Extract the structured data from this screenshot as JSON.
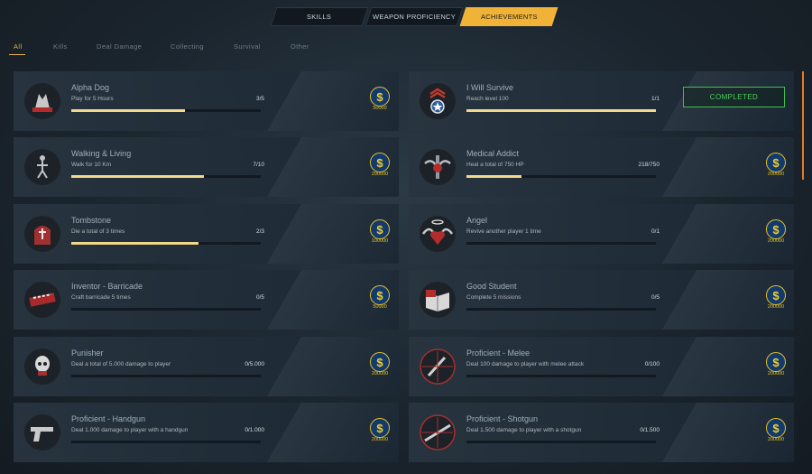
{
  "main_tabs": [
    {
      "label": "SKILLS",
      "active": false
    },
    {
      "label": "WEAPON PROFICIENCY",
      "active": false
    },
    {
      "label": "ACHIEVEMENTS",
      "active": true
    }
  ],
  "filters": [
    "All",
    "Kills",
    "Deal Damage",
    "Collecting",
    "Survival",
    "Other"
  ],
  "active_filter": "All",
  "colors": {
    "accent": "#f0b338",
    "progress": "#f2d88a",
    "completed": "#49d059",
    "coin_gold": "#e7c22b",
    "coin_blue": "#123a6d"
  },
  "achievements": [
    {
      "title": "Alpha Dog",
      "desc": "Play for 5 Hours",
      "count": "3/5",
      "progress": 0.6,
      "reward": "50000",
      "icon": "wolf-emblem-icon",
      "completed": false
    },
    {
      "title": "I Will Survive",
      "desc": "Reach level 100",
      "count": "1/1",
      "progress": 1.0,
      "reward": "",
      "icon": "military-rank-badge-icon",
      "completed": true,
      "status": "COMPLETED"
    },
    {
      "title": "Walking & Living",
      "desc": "Walk for 10 Km",
      "count": "7/10",
      "progress": 0.7,
      "reward": "200000",
      "icon": "walking-figure-icon",
      "completed": false
    },
    {
      "title": "Medical Addict",
      "desc": "Heal a total of 750 HP",
      "count": "218/750",
      "progress": 0.29,
      "reward": "200000",
      "icon": "winged-medic-emblem-icon",
      "completed": false
    },
    {
      "title": "Tombstone",
      "desc": "Die a total of 3 times",
      "count": "2/3",
      "progress": 0.67,
      "reward": "100000",
      "icon": "tombstone-icon",
      "completed": false
    },
    {
      "title": "Angel",
      "desc": "Revive another player 1 time",
      "count": "0/1",
      "progress": 0.0,
      "reward": "200000",
      "icon": "winged-heart-icon",
      "completed": false
    },
    {
      "title": "Inventor - Barricade",
      "desc": "Craft barricade 5 times",
      "count": "0/5",
      "progress": 0.0,
      "reward": "50000",
      "icon": "barricade-icon",
      "completed": false
    },
    {
      "title": "Good Student",
      "desc": "Complete 5 missions",
      "count": "0/5",
      "progress": 0.0,
      "reward": "200000",
      "icon": "open-book-icon",
      "completed": false
    },
    {
      "title": "Punisher",
      "desc": "Deal a total of 5.000 damage to player",
      "count": "0/5.000",
      "progress": 0.0,
      "reward": "200000",
      "icon": "skull-emblem-icon",
      "completed": false
    },
    {
      "title": "Proficient - Melee",
      "desc": "Deal 100 damage to player with melee attack",
      "count": "0/100",
      "progress": 0.0,
      "reward": "200000",
      "icon": "knife-crosshair-icon",
      "completed": false
    },
    {
      "title": "Proficient - Handgun",
      "desc": "Deal 1.000 damage to player with a handgun",
      "count": "0/1.000",
      "progress": 0.0,
      "reward": "200000",
      "icon": "handgun-icon",
      "completed": false
    },
    {
      "title": "Proficient - Shotgun",
      "desc": "Deal 1.500 damage to player with a shotgun",
      "count": "0/1.500",
      "progress": 0.0,
      "reward": "200000",
      "icon": "shotgun-crosshair-icon",
      "completed": false
    }
  ]
}
